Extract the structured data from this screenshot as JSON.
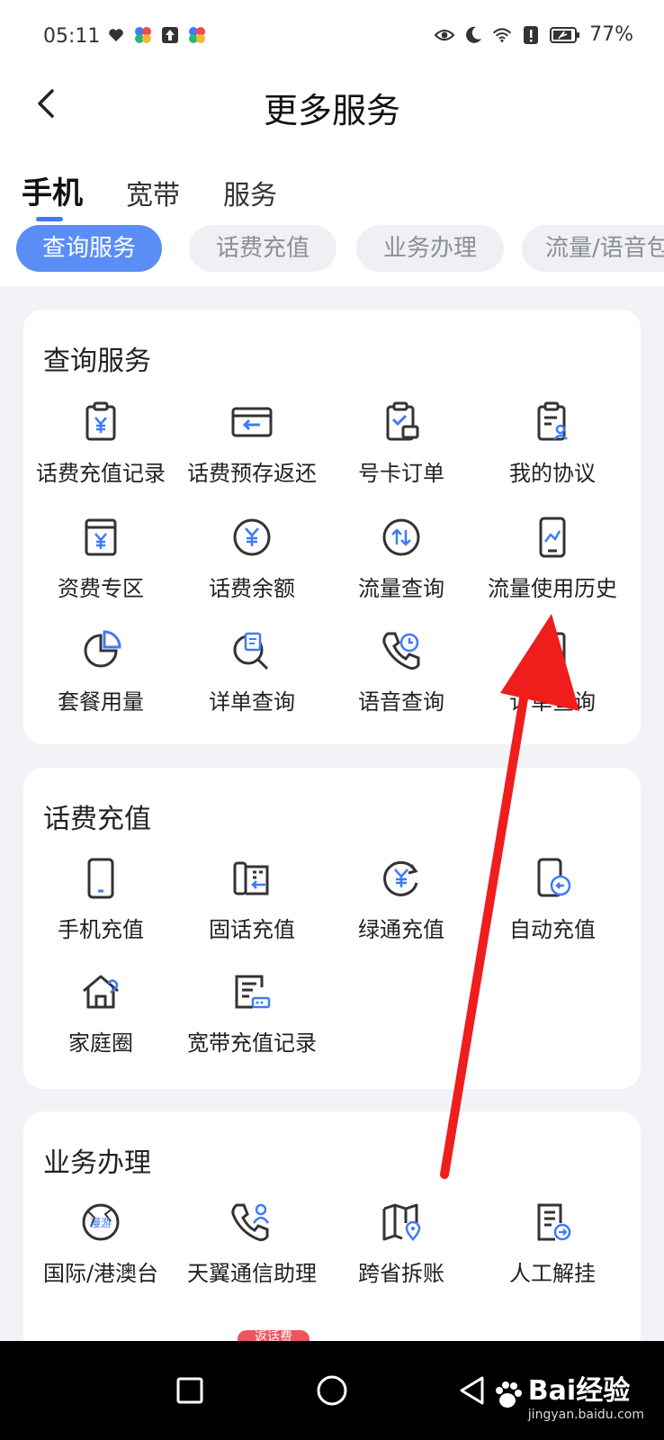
{
  "status": {
    "time": "05:11",
    "battery": "77%"
  },
  "header": {
    "title": "更多服务",
    "back_icon": "back-arrow-icon"
  },
  "top_tabs": [
    {
      "label": "手机",
      "active": true
    },
    {
      "label": "宽带",
      "active": false
    },
    {
      "label": "服务",
      "active": false
    }
  ],
  "chips": [
    {
      "label": "查询服务",
      "active": true
    },
    {
      "label": "话费充值",
      "active": false
    },
    {
      "label": "业务办理",
      "active": false
    },
    {
      "label": "流量/语音包",
      "active": false
    }
  ],
  "sections": [
    {
      "title": "查询服务",
      "items": [
        {
          "label": "话费充值记录",
          "icon": "receipt-yuan-icon"
        },
        {
          "label": "话费预存返还",
          "icon": "card-return-icon"
        },
        {
          "label": "号卡订单",
          "icon": "clipboard-check-icon"
        },
        {
          "label": "我的协议",
          "icon": "clipboard-user-icon"
        },
        {
          "label": "资费专区",
          "icon": "tariff-book-icon"
        },
        {
          "label": "话费余额",
          "icon": "yuan-circle-icon"
        },
        {
          "label": "流量查询",
          "icon": "data-updown-icon"
        },
        {
          "label": "流量使用历史",
          "icon": "phone-chart-icon"
        },
        {
          "label": "套餐用量",
          "icon": "pie-chart-icon"
        },
        {
          "label": "详单查询",
          "icon": "search-doc-icon"
        },
        {
          "label": "语音查询",
          "icon": "phone-clock-icon"
        },
        {
          "label": "订单查询",
          "icon": "order-doc-icon"
        }
      ]
    },
    {
      "title": "话费充值",
      "items": [
        {
          "label": "手机充值",
          "icon": "mobile-phone-icon"
        },
        {
          "label": "固话充值",
          "icon": "landline-icon"
        },
        {
          "label": "绿通充值",
          "icon": "yuan-refresh-icon"
        },
        {
          "label": "自动充值",
          "icon": "phone-refresh-icon"
        },
        {
          "label": "家庭圈",
          "icon": "home-heart-icon"
        },
        {
          "label": "宽带充值记录",
          "icon": "broadband-doc-icon"
        }
      ]
    },
    {
      "title": "业务办理",
      "items": [
        {
          "label": "国际/港澳台",
          "icon": "roaming-globe-icon",
          "icon_text": "漫游"
        },
        {
          "label": "天翼通信助理",
          "icon": "phone-user-icon"
        },
        {
          "label": "跨省拆账",
          "icon": "map-pin-icon"
        },
        {
          "label": "人工解挂",
          "icon": "doc-arrow-icon"
        }
      ],
      "badge": "返话费"
    }
  ],
  "system_nav": {
    "recent_icon": "square-icon",
    "home_icon": "circle-icon",
    "back_icon": "triangle-back-icon"
  },
  "watermark": {
    "logo": "Bai经验",
    "sub": "jingyan.baidu.com"
  },
  "colors": {
    "accent": "#5b8df6",
    "annotation_arrow": "#f01d1d"
  }
}
